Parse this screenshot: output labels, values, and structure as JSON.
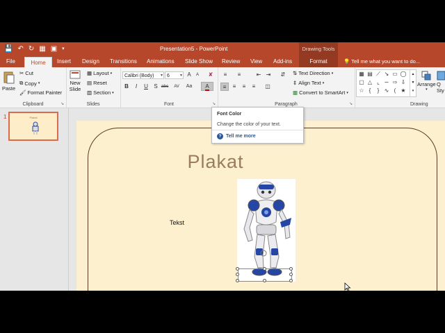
{
  "window": {
    "document_title": "Presentation5 - PowerPoint",
    "context_group": "Drawing Tools"
  },
  "qat": {
    "save_icon": "save-icon",
    "undo_icon": "undo-icon",
    "redo_icon": "redo-icon",
    "presenter_icon": "start-from-beginning-icon",
    "more_icon": "customize-qat-icon"
  },
  "tabs": [
    "File",
    "Home",
    "Insert",
    "Design",
    "Transitions",
    "Animations",
    "Slide Show",
    "Review",
    "View",
    "Add-ins",
    "Format"
  ],
  "active_tab": "Home",
  "tell_me": "Tell me what you want to do...",
  "ribbon": {
    "clipboard": {
      "label": "Clipboard",
      "paste": "Paste",
      "cut": "Cut",
      "copy": "Copy",
      "format_painter": "Format Painter"
    },
    "slides": {
      "label": "Slides",
      "new_slide_1": "New",
      "new_slide_2": "Slide",
      "layout": "Layout",
      "reset": "Reset",
      "section": "Section"
    },
    "font": {
      "label": "Font",
      "font_name": "Calibri (Body)",
      "font_size": "6",
      "bold": "B",
      "italic": "I",
      "underline": "U",
      "shadow": "S",
      "strike": "abc",
      "spacing": "AV",
      "case": "Aa",
      "font_color": "A",
      "grow": "A",
      "shrink": "A"
    },
    "paragraph": {
      "label": "Paragraph",
      "text_direction": "Text Direction",
      "align_text": "Align Text",
      "convert_smartart": "Convert to SmartArt"
    },
    "drawing": {
      "label": "Drawing",
      "arrange": "Arrange",
      "quick_styles_1": "Q",
      "quick_styles_2": "Sty"
    }
  },
  "slide_pane": {
    "slide_number": "1",
    "thumb_title": "Plakat"
  },
  "slide": {
    "title": "Plakat",
    "text": "Tekst"
  },
  "tooltip": {
    "title": "Font Color",
    "description": "Change the color of your text.",
    "more": "Tell me more"
  },
  "colors": {
    "accent": "#b7472a",
    "context_tab": "#943a22",
    "slide_bg": "#fdf0cf",
    "title_color": "#9a7c5e"
  }
}
